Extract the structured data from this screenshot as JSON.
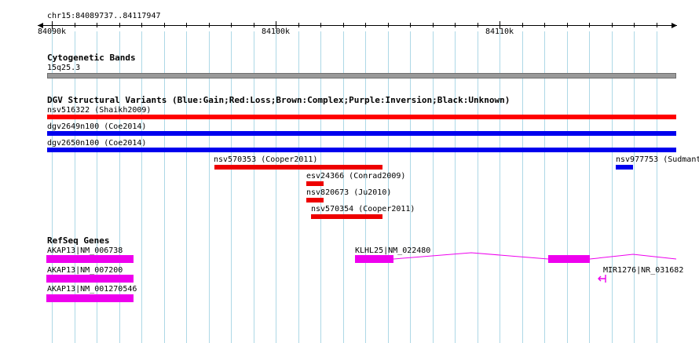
{
  "ruler": {
    "location": "chr15:84089737..84117947",
    "ticks": [
      "84090k",
      "84100k",
      "84110k"
    ]
  },
  "tracks": {
    "cytoband": {
      "title": "Cytogenetic Bands",
      "band": "15q25.3"
    },
    "dgv": {
      "title": "DGV Structural Variants (Blue:Gain;Red:Loss;Brown:Complex;Purple:Inversion;Black:Unknown)",
      "features": [
        {
          "label": "nsv516322 (Shaikh2009)",
          "color": "#ff0000"
        },
        {
          "label": "dgv2649n100 (Coe2014)",
          "color": "#0000ee"
        },
        {
          "label": "dgv2650n100 (Coe2014)",
          "color": "#0000ee"
        },
        {
          "label": "nsv570353 (Cooper2011)",
          "color": "#ee0000"
        },
        {
          "label": "nsv977753 (Sudmant",
          "color": "#0000ee"
        },
        {
          "label": "esv24366 (Conrad2009)",
          "color": "#ee0000"
        },
        {
          "label": "nsv820673 (Ju2010)",
          "color": "#ee0000"
        },
        {
          "label": "nsv570354 (Cooper2011)",
          "color": "#ee0000"
        }
      ]
    },
    "refseq": {
      "title": "RefSeq Genes",
      "color": "#ee00ee",
      "genes": [
        {
          "label": "AKAP13|NM_006738"
        },
        {
          "label": "AKAP13|NM_007200"
        },
        {
          "label": "AKAP13|NM_001270546"
        },
        {
          "label": "KLHL25|NM_022480"
        },
        {
          "label": "MIR1276|NR_031682"
        }
      ]
    }
  }
}
